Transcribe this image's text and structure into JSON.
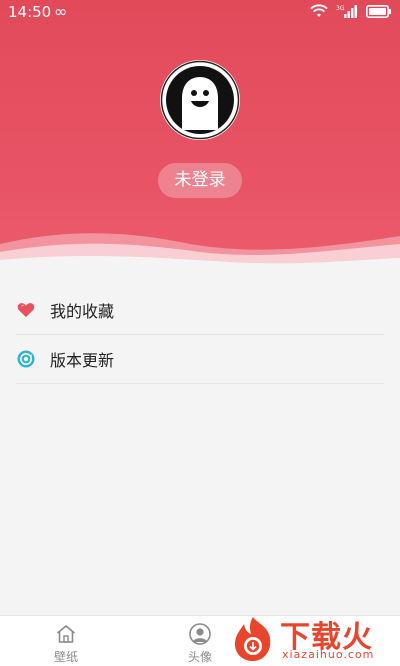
{
  "status_bar": {
    "time": "14:50",
    "infinity_symbol": "∞",
    "network_label": "3G"
  },
  "profile": {
    "avatar_icon": "smiley-ghost-icon",
    "login_label": "未登录"
  },
  "menu": {
    "items": [
      {
        "label": "我的收藏",
        "icon": "heart-icon"
      },
      {
        "label": "版本更新",
        "icon": "refresh-eye-icon"
      }
    ]
  },
  "bottom_nav": {
    "items": [
      {
        "label": "壁纸",
        "icon": "home-icon"
      },
      {
        "label": "头像",
        "icon": "person-icon"
      }
    ]
  },
  "watermark": {
    "brand": "下载火",
    "url": "xiazaihuo.com"
  },
  "colors": {
    "header_red": "#e24a5a",
    "background": "#f4f4f4",
    "heart": "#e8525d",
    "update_icon": "#2bb6d2",
    "watermark": "#e8452c"
  }
}
